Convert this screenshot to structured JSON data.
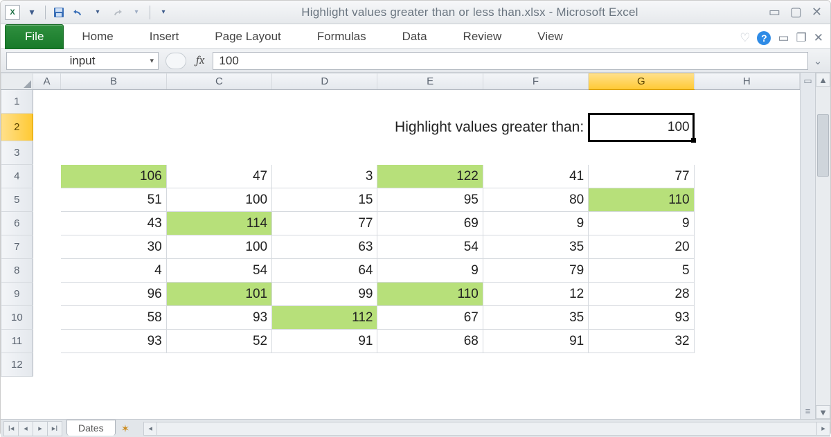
{
  "titlebar": {
    "title": "Highlight values greater than or less than.xlsx  -  Microsoft Excel",
    "qat": {
      "excel_glyph": "X",
      "dd1": "▾",
      "dd2": "▾",
      "dd3": "▾"
    }
  },
  "ribbon": {
    "file": "File",
    "tabs": [
      "Home",
      "Insert",
      "Page Layout",
      "Formulas",
      "Data",
      "Review",
      "View"
    ]
  },
  "formula": {
    "namebox": "input",
    "fx": "fx",
    "value": "100"
  },
  "sheet": {
    "columns": [
      "A",
      "B",
      "C",
      "D",
      "E",
      "F",
      "G",
      "H"
    ],
    "active_col": "G",
    "active_row": 2,
    "label_text": "Highlight values greater than:",
    "input_value": "100",
    "rows_visible": 12,
    "data_start_row": 4,
    "data": [
      [
        106,
        47,
        3,
        122,
        41,
        77
      ],
      [
        51,
        100,
        15,
        95,
        80,
        110
      ],
      [
        43,
        114,
        77,
        69,
        9,
        9
      ],
      [
        30,
        100,
        63,
        54,
        35,
        20
      ],
      [
        4,
        54,
        64,
        9,
        79,
        5
      ],
      [
        96,
        101,
        99,
        110,
        12,
        28
      ],
      [
        58,
        93,
        112,
        67,
        35,
        93
      ],
      [
        93,
        52,
        91,
        68,
        91,
        32
      ]
    ],
    "threshold": 100,
    "tab_name": "Dates"
  }
}
